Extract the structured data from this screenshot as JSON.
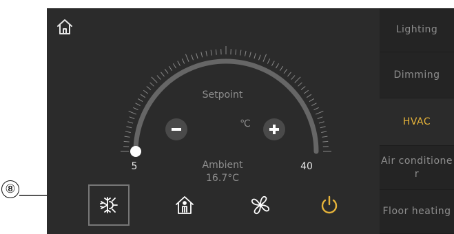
{
  "sidebar": {
    "items": [
      {
        "label": "Lighting",
        "active": false
      },
      {
        "label": "Dimming",
        "active": false
      },
      {
        "label": "HVAC",
        "active": true
      },
      {
        "label": "Air conditioner",
        "active": false
      },
      {
        "label": "Floor heating",
        "active": false
      }
    ]
  },
  "thermostat": {
    "setpoint_label": "Setpoint",
    "unit": "℃",
    "min_label": "5",
    "max_label": "40",
    "setpoint_value": 5,
    "ambient_label": "Ambient",
    "ambient_value": "16.7°C"
  },
  "bottom_bar": {
    "buttons": [
      {
        "icon": "snowflake-sun-icon",
        "selected": true
      },
      {
        "icon": "home-person-icon",
        "selected": false
      },
      {
        "icon": "fan-icon",
        "selected": false
      },
      {
        "icon": "power-icon",
        "selected": false
      }
    ]
  },
  "annotation": {
    "callout_number": "⑧"
  },
  "colors": {
    "panel_bg": "#2b2b2b",
    "sidebar_bg": "#242424",
    "accent": "#e7b43a",
    "arc": "#666666",
    "text_muted": "#8e8e8e"
  }
}
